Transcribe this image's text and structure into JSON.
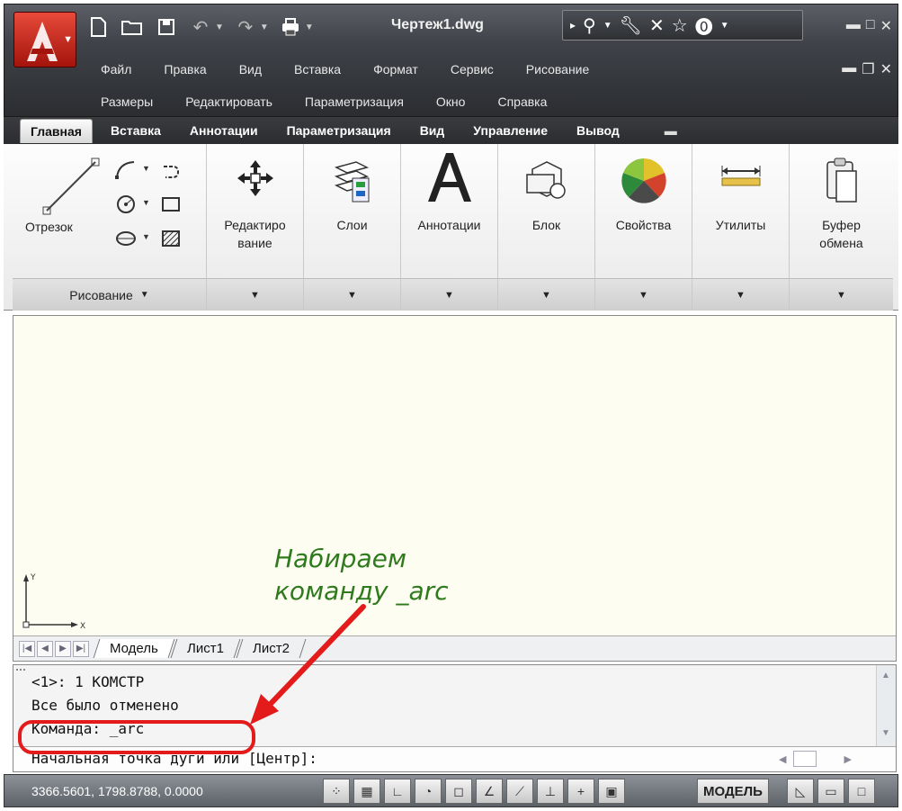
{
  "window": {
    "title": "Чертеж1.dwg"
  },
  "menu": {
    "row1": [
      "Файл",
      "Правка",
      "Вид",
      "Вставка",
      "Формат",
      "Сервис",
      "Рисование"
    ],
    "row2": [
      "Размеры",
      "Редактировать",
      "Параметризация",
      "Окно",
      "Справка"
    ]
  },
  "ribbon": {
    "tabs": [
      "Главная",
      "Вставка",
      "Аннотации",
      "Параметризация",
      "Вид",
      "Управление",
      "Вывод"
    ],
    "active_tab": "Главная",
    "panels": {
      "draw": {
        "tool_label": "Отрезок",
        "footer": "Рисование"
      },
      "modify": {
        "label_line1": "Редактиро",
        "label_line2": "вание"
      },
      "layers": {
        "label": "Слои"
      },
      "annotation": {
        "label": "Аннотации"
      },
      "block": {
        "label": "Блок"
      },
      "properties": {
        "label": "Свойства"
      },
      "utilities": {
        "label": "Утилиты"
      },
      "clipboard": {
        "label_line1": "Буфер",
        "label_line2": "обмена"
      }
    }
  },
  "drawing": {
    "annotation_line1": "Набираем",
    "annotation_line2": "команду _arc",
    "layout_tabs": [
      "Модель",
      "Лист1",
      "Лист2"
    ],
    "active_layout": "Модель"
  },
  "command": {
    "history": [
      "<1>: 1 КОМСТР",
      "Все было отменено",
      "Команда: _arc"
    ],
    "prompt": "Начальная точка дуги или [Центр]:"
  },
  "status": {
    "coordinates": "3366.5601, 1798.8788, 0.0000",
    "model_label": "МОДЕЛЬ"
  },
  "colors": {
    "annotation_text": "#2f7a1d",
    "highlight": "#e31b1b",
    "drawing_background": "#fefdf2"
  }
}
